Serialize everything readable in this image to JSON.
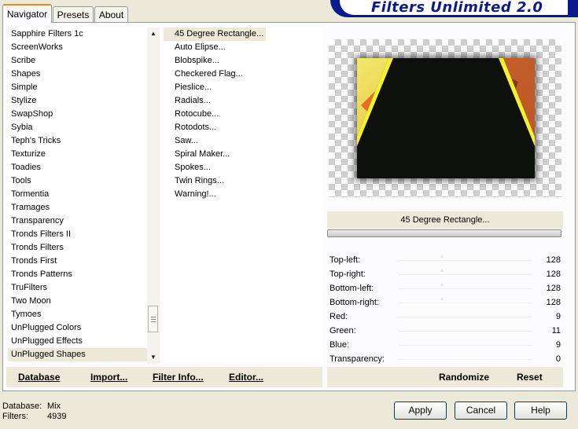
{
  "tabs": [
    "Navigator",
    "Presets",
    "About"
  ],
  "banner_title": "Filters Unlimited 2.0",
  "categories": [
    "Sapphire Filters 1c",
    "ScreenWorks",
    "Scribe",
    "Shapes",
    "Simple",
    "Stylize",
    "SwapShop",
    "Sybia",
    "Teph's Tricks",
    "Texturize",
    "Toadies",
    "Tools",
    "Tormentia",
    "Tramages",
    "Transparency",
    "Tronds Filters II",
    "Tronds Filters",
    "Tronds First",
    "Tronds Patterns",
    "TruFilters",
    "Two Moon",
    "Tymoes",
    "UnPlugged Colors",
    "UnPlugged Effects",
    "UnPlugged Shapes"
  ],
  "selected_category": "UnPlugged Shapes",
  "filters": [
    "45 Degree Rectangle...",
    "Auto Elipse...",
    "Blobspike...",
    "Checkered Flag...",
    "Pieslice...",
    "Radials...",
    "Rotocube...",
    "Rotodots...",
    "Saw...",
    "Spiral Maker...",
    "Spokes...",
    "Twin Rings...",
    "Warning!..."
  ],
  "selected_filter": "45 Degree Rectangle...",
  "left_buttons": {
    "database": "Database",
    "import": "Import...",
    "filter_info": "Filter Info...",
    "editor": "Editor..."
  },
  "current_filter_name": "45 Degree Rectangle...",
  "params": [
    {
      "label": "Top-left:",
      "value": "128"
    },
    {
      "label": "Top-right:",
      "value": "128"
    },
    {
      "label": "Bottom-left:",
      "value": "128"
    },
    {
      "label": "Bottom-right:",
      "value": "128"
    },
    {
      "label": "Red:",
      "value": "9"
    },
    {
      "label": "Green:",
      "value": "11"
    },
    {
      "label": "Blue:",
      "value": "9"
    },
    {
      "label": "Transparency:",
      "value": "0"
    }
  ],
  "right_buttons": {
    "randomize": "Randomize",
    "reset": "Reset"
  },
  "status": {
    "database_label": "Database:",
    "database_value": "Mix",
    "filters_label": "Filters:",
    "filters_value": "4939"
  },
  "dialog_buttons": {
    "apply": "Apply",
    "cancel": "Cancel",
    "help": "Help"
  },
  "colors": {
    "accent_tab": "#e68b2c",
    "banner": "#0b1a8c",
    "selection": "#ece9d8"
  }
}
